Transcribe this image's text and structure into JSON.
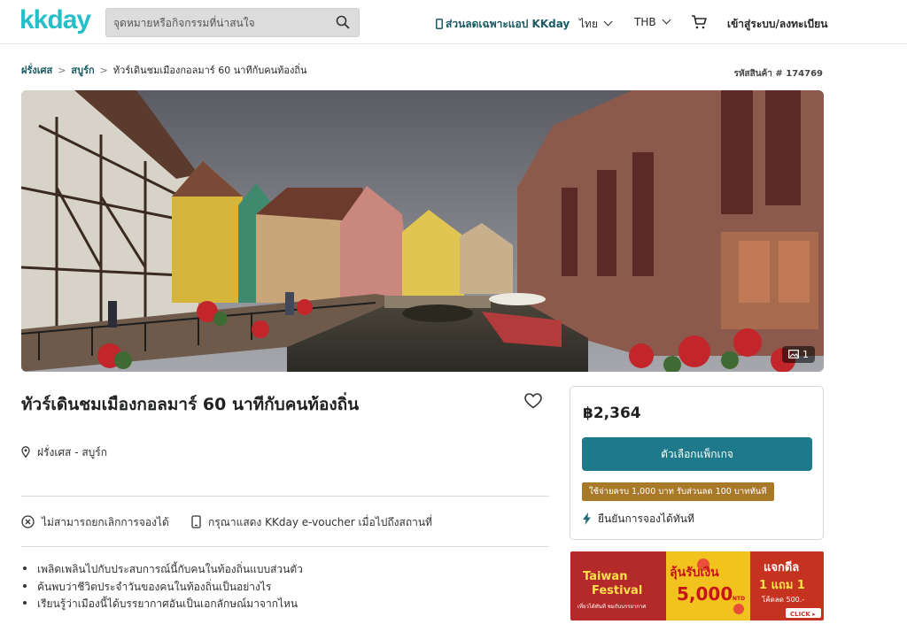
{
  "header": {
    "logo": "kkday",
    "search_placeholder": "จุดหมายหรือกิจกรรมที่น่าสนใจ",
    "app_promo": "ส่วนลดเฉพาะแอป KKday",
    "language": "ไทย",
    "currency": "THB",
    "login": "เข้าสู่ระบบ/ลงทะเบียน"
  },
  "breadcrumb": {
    "items": [
      "ฝรั่งเศส",
      "สบูร์ก"
    ],
    "current": "ทัวร์เดินชมเมืองกอลมาร์ 60 นาทีกับคนท้องถิ่น"
  },
  "product_code": "รหัสสินค้า # 174769",
  "gallery": {
    "photo_count": "1"
  },
  "product": {
    "title": "ทัวร์เดินชมเมืองกอลมาร์ 60 นาทีกับคนท้องถิ่น",
    "location": "ฝรั่งเศส - สบูร์ก",
    "policy_cancel": "ไม่สามารถยกเลิกการจองได้",
    "policy_voucher": "กรุณาแสดง KKday e-voucher เมื่อไปถึงสถานที่",
    "highlights": [
      "เพลิดเพลินไปกับประสบการณ์นี้กับคนในท้องถิ่นแบบส่วนตัว",
      "ค้นพบว่าชีวิตประจำวันของคนในท้องถิ่นเป็นอย่างไร",
      "เรียนรู้ว่าเมืองนี้ได้บรรยากาศอันเป็นเอกลักษณ์มาจากไหน"
    ]
  },
  "booking": {
    "price": "฿2,364",
    "package_button": "ตัวเลือกแพ็กเกจ",
    "promo": "ใช้จ่ายครบ 1,000 บาท รับส่วนลด 100 บาททันที",
    "instant_confirm": "ยืนยันการจองได้ทันที"
  },
  "banner": {
    "title": "Taiwan Festival",
    "sub": "เที่ยวได้ทันที ชมกับบรรยากาศ",
    "offer": "ลุ้นรับเงิน",
    "amount": "5,000",
    "unit": "NTD",
    "deal": "แจกดีล",
    "deal2": "1 แถม 1",
    "deal3": "โค้ดลด 500.-",
    "cta": "CLICK ▸"
  },
  "colors": {
    "brand": "#26bec9",
    "button": "#1e7a8a",
    "promo": "#a9792a"
  }
}
